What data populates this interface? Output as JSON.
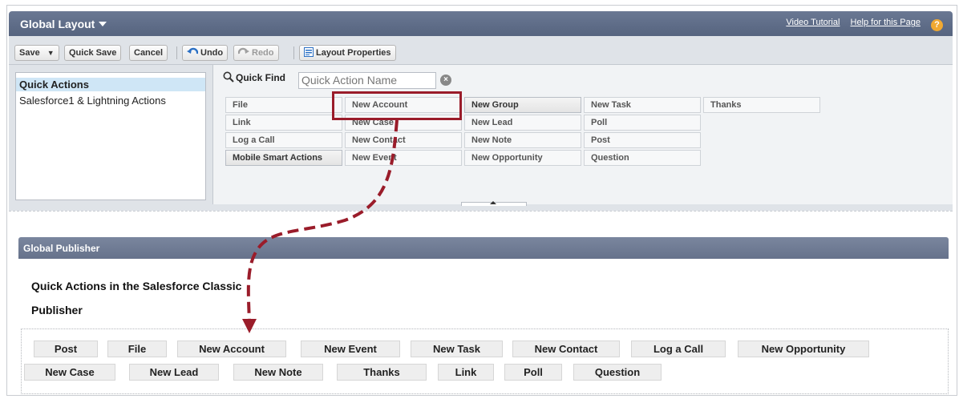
{
  "window": {
    "title": "Global Layout",
    "links": {
      "video": "Video Tutorial",
      "help": "Help for this Page"
    },
    "help_badge": "?"
  },
  "toolbar": {
    "save": "Save",
    "save_dropdown": "▼",
    "quick_save": "Quick Save",
    "cancel": "Cancel",
    "undo": "Undo",
    "redo": "Redo",
    "layout_properties": "Layout Properties"
  },
  "sidebar": {
    "items": [
      {
        "label": "Quick Actions",
        "selected": true
      },
      {
        "label": "Salesforce1 & Lightning Actions",
        "selected": false
      }
    ]
  },
  "quickfind": {
    "label": "Quick Find",
    "placeholder": "Quick Action Name",
    "clear": "×"
  },
  "palette": {
    "columns": [
      [
        "File",
        "Link",
        "Log a Call",
        "Mobile Smart Actions"
      ],
      [
        "New Account",
        "New Case",
        "New Contact",
        "New Event"
      ],
      [
        "New Group",
        "New Lead",
        "New Note",
        "New Opportunity"
      ],
      [
        "New Task",
        "Poll",
        "Post",
        "Question"
      ],
      [
        "Thanks"
      ]
    ]
  },
  "publisher": {
    "header": "Global Publisher",
    "section_title_line1": "Quick Actions in the Salesforce Classic",
    "section_title_line2": "Publisher",
    "row1": [
      "Post",
      "File",
      "New Account",
      "New Event",
      "New Task",
      "New Contact",
      "Log a Call",
      "New Opportunity"
    ],
    "row2": [
      "New Case",
      "New Lead",
      "New Note",
      "Thanks",
      "Link",
      "Poll",
      "Question"
    ]
  },
  "colors": {
    "header": "#5f6d89",
    "highlight": "#9a1c2a",
    "arrow": "#9a1c2a"
  }
}
